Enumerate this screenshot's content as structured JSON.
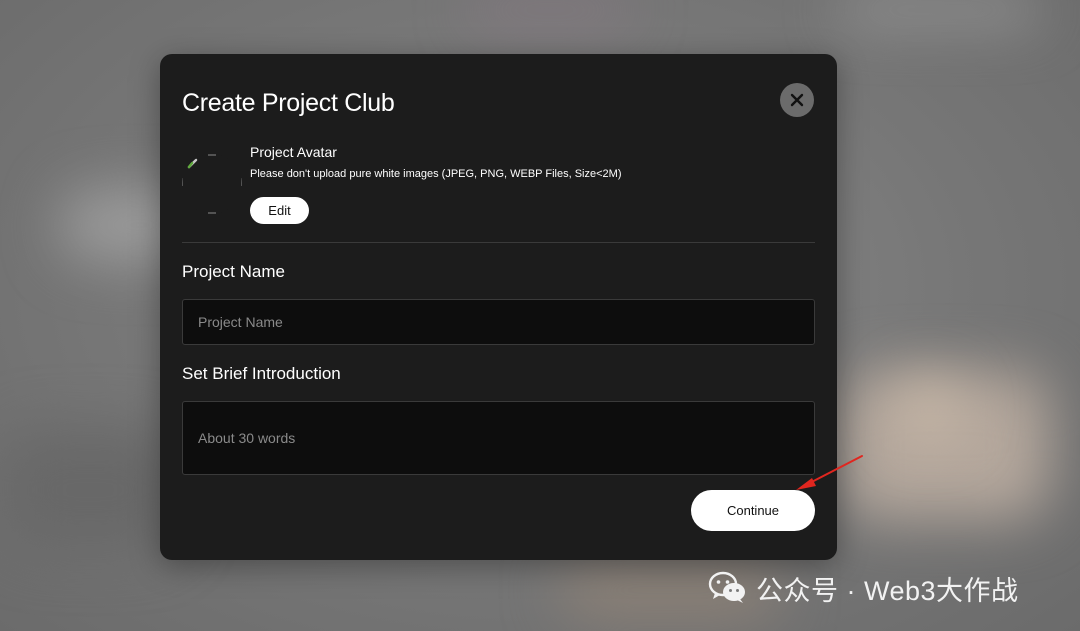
{
  "modal": {
    "title": "Create Project Club",
    "close_icon": "close-icon"
  },
  "avatar": {
    "label": "Project Avatar",
    "hint": "Please don't upload pure white images (JPEG, PNG, WEBP Files, Size<2M)",
    "edit_label": "Edit"
  },
  "project_name": {
    "label": "Project Name",
    "placeholder": "Project Name",
    "value": ""
  },
  "brief_intro": {
    "label": "Set Brief Introduction",
    "placeholder": "About 30 words",
    "value": ""
  },
  "continue_label": "Continue",
  "annotation": {
    "arrow_color": "#e0261f"
  },
  "watermark": {
    "icon": "wechat-icon",
    "text": "公众号 · Web3大作战"
  },
  "colors": {
    "modal_bg": "#1c1c1c",
    "input_bg": "#0d0d0d",
    "button_bg": "#ffffff",
    "close_bg": "#6b6b6b"
  }
}
